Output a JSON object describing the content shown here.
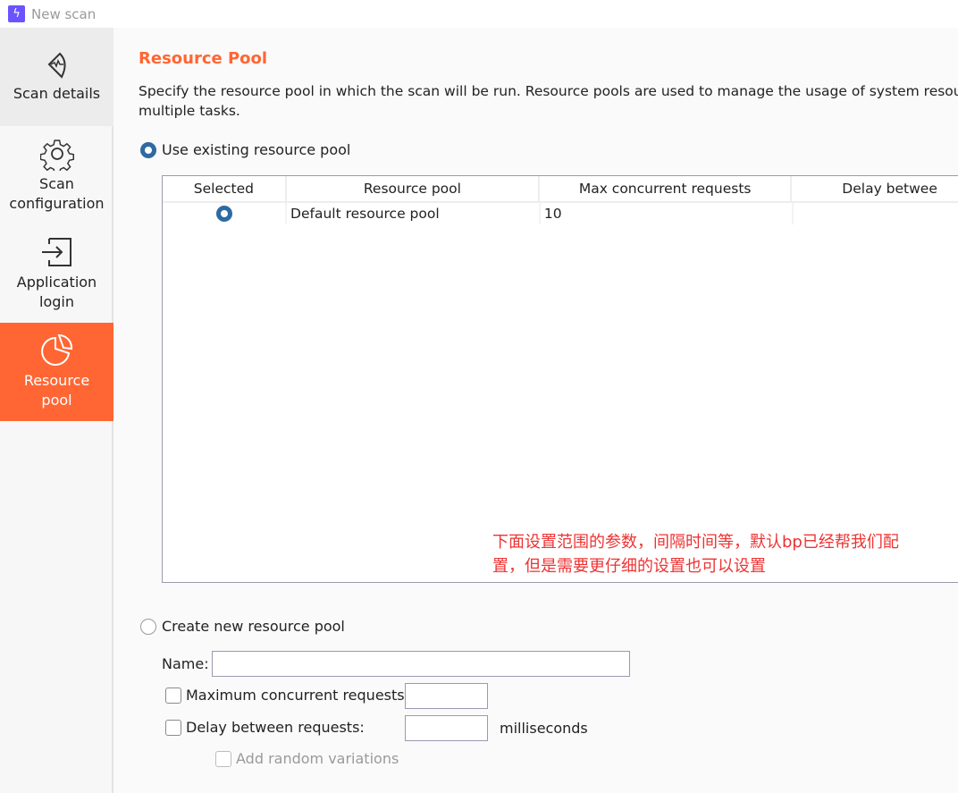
{
  "window": {
    "title": "New scan",
    "app_icon": "lightning-bolt-icon",
    "accent_color": "#ff6633"
  },
  "sidebar": {
    "items": [
      {
        "label_lines": [
          "Scan details"
        ],
        "icon": "scan-details-icon",
        "state": "selected"
      },
      {
        "label_lines": [
          "Scan",
          "configuration"
        ],
        "icon": "gear-icon",
        "state": "normal"
      },
      {
        "label_lines": [
          "Application",
          "login"
        ],
        "icon": "login-arrow-icon",
        "state": "normal"
      },
      {
        "label_lines": [
          "Resource",
          "pool"
        ],
        "icon": "pie-chart-icon",
        "state": "active"
      }
    ]
  },
  "main": {
    "title": "Resource Pool",
    "description_line1": "Specify the resource pool in which the scan will be run. Resource pools are used to manage the usage of system resourc",
    "description_line2": "multiple tasks.",
    "use_existing": {
      "label": "Use existing resource pool",
      "checked": true
    },
    "table": {
      "columns": [
        "Selected",
        "Resource pool",
        "Max concurrent requests",
        "Delay betwee"
      ],
      "rows": [
        {
          "selected": true,
          "name": "Default resource pool",
          "max_concurrent": "10",
          "delay": ""
        }
      ]
    },
    "annotation": {
      "line1": "下面设置范围的参数，间隔时间等，默认bp已经帮我们配",
      "line2": "置，但是需要更仔细的设置也可以设置",
      "color": "#ee3333"
    },
    "create_new": {
      "label": "Create new resource pool",
      "checked": false,
      "name_label": "Name:",
      "name_value": "",
      "max_concurrent_label": "Maximum concurrent requests:",
      "max_concurrent_value": "",
      "max_concurrent_checked": false,
      "delay_label": "Delay between requests:",
      "delay_value": "",
      "delay_checked": false,
      "delay_unit": "milliseconds",
      "random_label": "Add random variations",
      "random_checked": false,
      "random_disabled": true
    }
  }
}
